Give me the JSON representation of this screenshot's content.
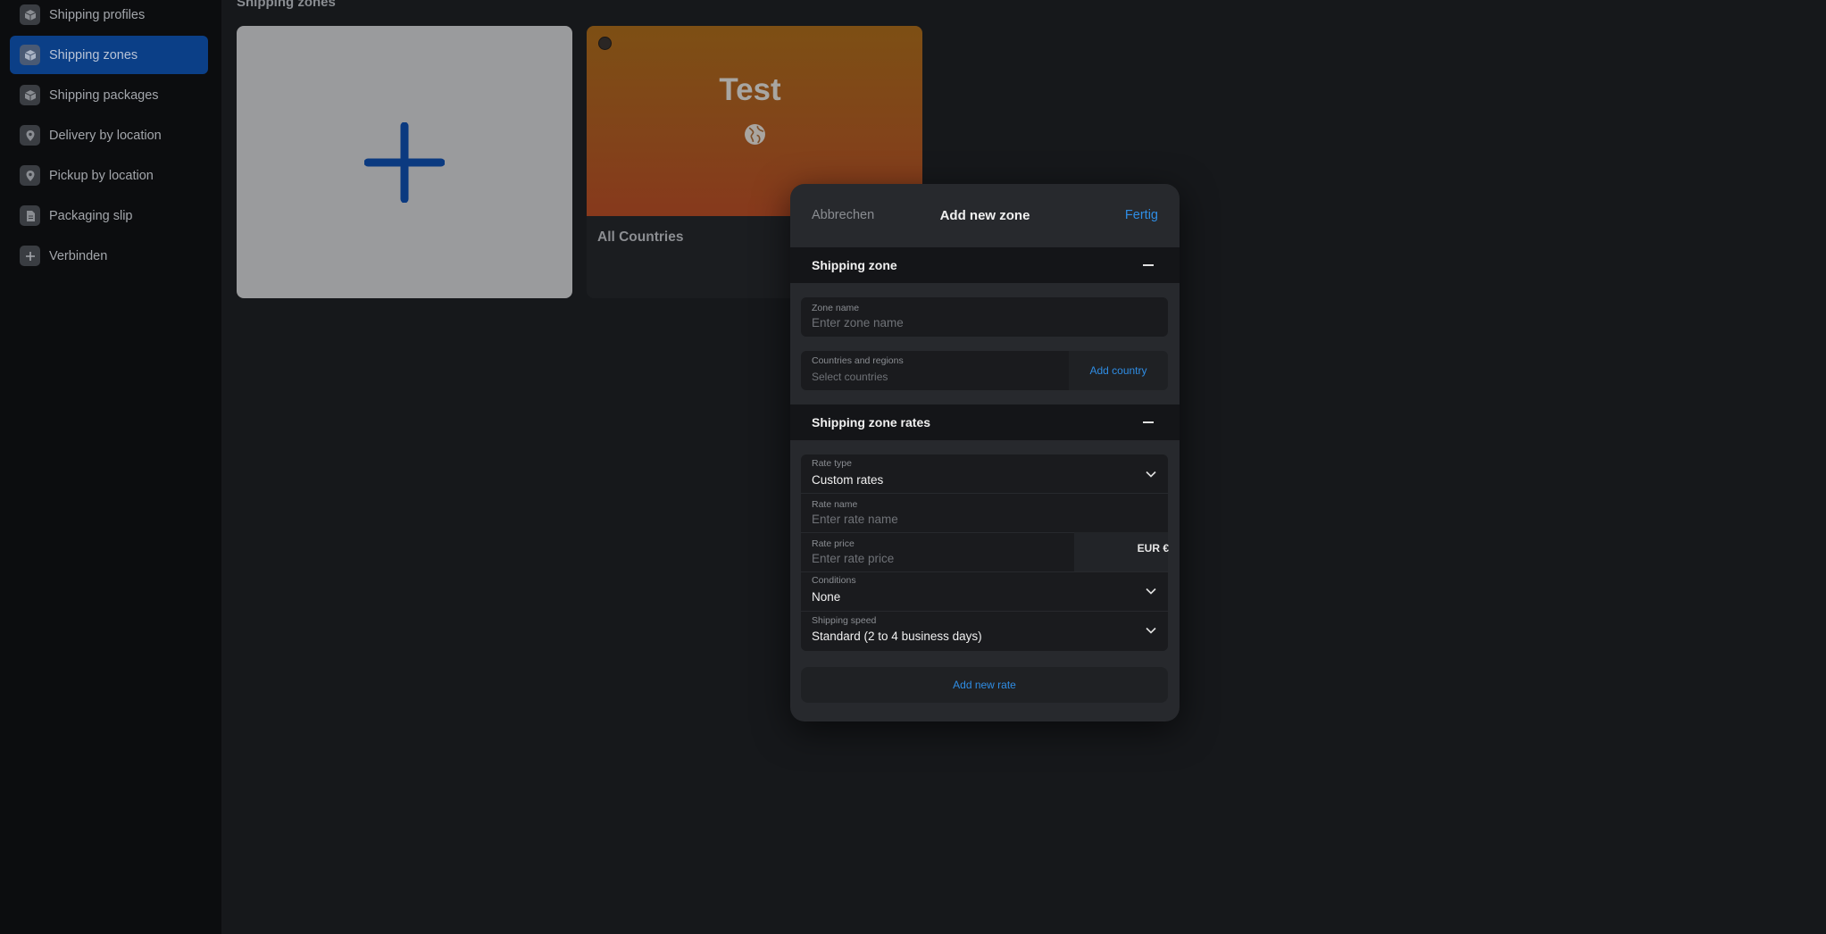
{
  "sidebar": {
    "items": [
      {
        "label": "Shipping profiles",
        "icon": "box-icon",
        "active": false
      },
      {
        "label": "Shipping zones",
        "icon": "box-icon",
        "active": true
      },
      {
        "label": "Shipping packages",
        "icon": "box-icon",
        "active": false
      },
      {
        "label": "Delivery by location",
        "icon": "location-pin-icon",
        "active": false
      },
      {
        "label": "Pickup by location",
        "icon": "location-pin-icon",
        "active": false
      },
      {
        "label": "Packaging slip",
        "icon": "document-icon",
        "active": false
      },
      {
        "label": "Verbinden",
        "icon": "plus-icon",
        "active": false
      }
    ]
  },
  "main": {
    "section_title": "Shipping zones",
    "zone_card": {
      "banner_title": "Test",
      "name": "All Countries"
    }
  },
  "dialog": {
    "cancel_label": "Abbrechen",
    "title": "Add new zone",
    "done_label": "Fertig",
    "shipping_zone": {
      "heading": "Shipping zone",
      "zone_name_label": "Zone name",
      "zone_name_placeholder": "Enter zone name",
      "countries_label": "Countries and regions",
      "countries_placeholder": "Select countries",
      "add_country_label": "Add country"
    },
    "rates": {
      "heading": "Shipping zone rates",
      "rate_type_label": "Rate type",
      "rate_type_value": "Custom rates",
      "rate_name_label": "Rate name",
      "rate_name_placeholder": "Enter rate name",
      "rate_price_label": "Rate price",
      "rate_price_placeholder": "Enter rate price",
      "currency": "EUR €",
      "conditions_label": "Conditions",
      "conditions_value": "None",
      "speed_label": "Shipping speed",
      "speed_value": "Standard (2 to 4 business days)",
      "add_rate_label": "Add new rate"
    }
  },
  "colors": {
    "accent": "#2f8de4",
    "active_nav": "#0b3f87",
    "zone_banner": "#82431a"
  }
}
